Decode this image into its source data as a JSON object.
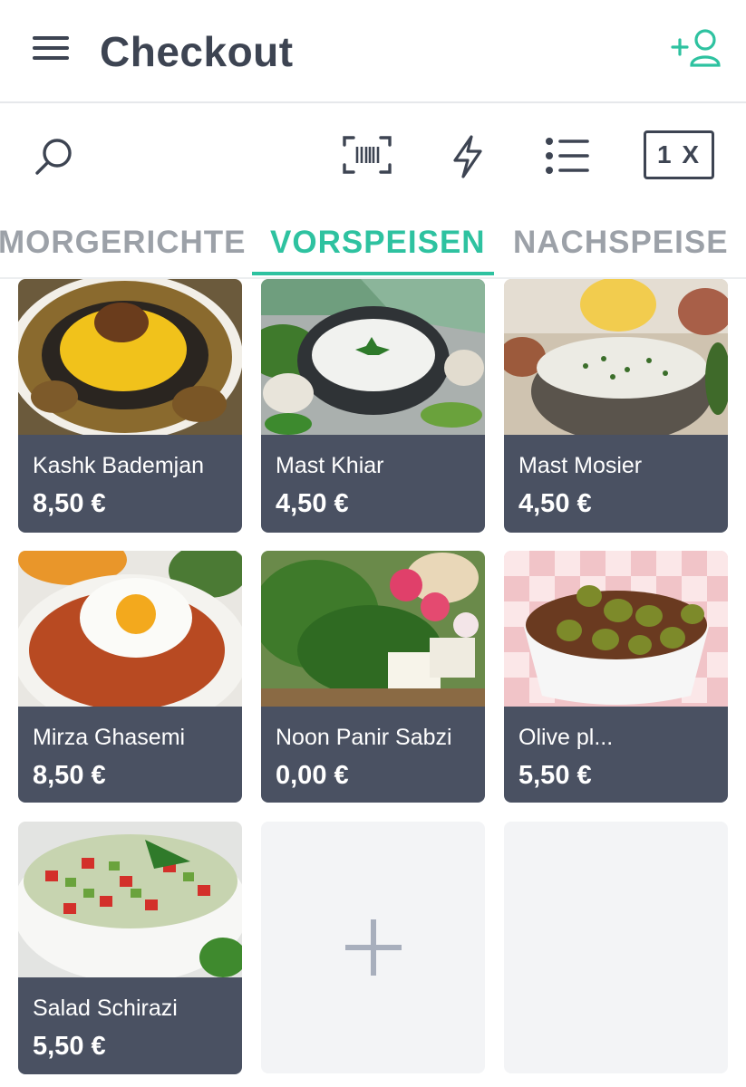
{
  "header": {
    "title": "Checkout",
    "menu_icon": "hamburger-menu-icon",
    "add_customer_icon": "add-user-icon"
  },
  "toolbar": {
    "quantity": "1 X"
  },
  "tabs": [
    {
      "label": "MORGERICHTE",
      "active": false
    },
    {
      "label": "VORSPEISEN",
      "active": true
    },
    {
      "label": "NACHSPEISE",
      "active": false
    }
  ],
  "products": [
    {
      "name": "Kashk Bademjan",
      "price": "8,50 €"
    },
    {
      "name": "Mast Khiar",
      "price": "4,50 €"
    },
    {
      "name": "Mast Mosier",
      "price": "4,50 €"
    },
    {
      "name": "Mirza Ghasemi",
      "price": "8,50 €"
    },
    {
      "name": "Noon Panir Sabzi",
      "price": "0,00 €"
    },
    {
      "name": "Olive pl...",
      "price": "5,50 €"
    },
    {
      "name": "Salad Schirazi",
      "price": "5,50 €"
    }
  ],
  "colors": {
    "accent": "#2ec2a0",
    "dark": "#3d4452",
    "card_footer": "#4a5162",
    "tab_inactive": "#9ca1a8"
  }
}
